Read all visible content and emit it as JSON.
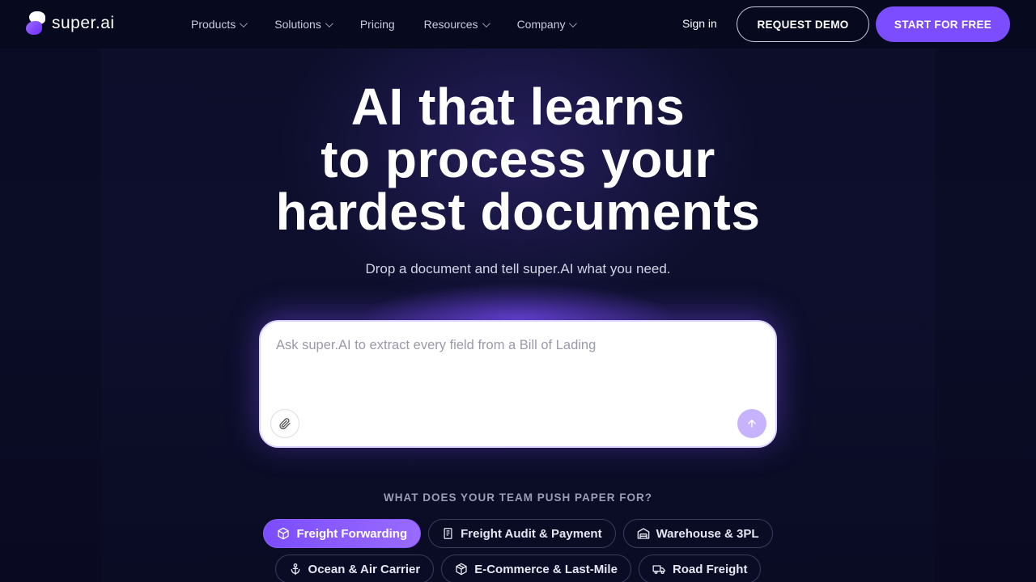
{
  "brand": {
    "name": "super.ai",
    "accent": "#7b4dff"
  },
  "nav": {
    "items": [
      {
        "label": "Products",
        "has_menu": true
      },
      {
        "label": "Solutions",
        "has_menu": true
      },
      {
        "label": "Pricing",
        "has_menu": false
      },
      {
        "label": "Resources",
        "has_menu": true
      },
      {
        "label": "Company",
        "has_menu": true
      }
    ],
    "sign_in": "Sign in",
    "request_demo": "REQUEST DEMO",
    "start_free": "START FOR FREE"
  },
  "hero": {
    "title_lines": [
      "AI that learns",
      "to process your",
      "hardest documents"
    ],
    "subtitle": "Drop a document and tell super.AI what you need."
  },
  "prompt": {
    "placeholder": "Ask super.AI to extract every field from a Bill of Lading",
    "attach_icon": "paperclip-icon",
    "send_icon": "arrow-up-icon"
  },
  "question": "WHAT DOES YOUR TEAM PUSH PAPER FOR?",
  "chips": [
    {
      "label": "Freight Forwarding",
      "icon": "box-icon",
      "active": true
    },
    {
      "label": "Freight Audit & Payment",
      "icon": "receipt-icon",
      "active": false
    },
    {
      "label": "Warehouse & 3PL",
      "icon": "warehouse-icon",
      "active": false
    },
    {
      "label": "Ocean & Air Carrier",
      "icon": "anchor-icon",
      "active": false
    },
    {
      "label": "E-Commerce & Last-Mile",
      "icon": "package-icon",
      "active": false
    },
    {
      "label": "Road Freight",
      "icon": "truck-icon",
      "active": false
    }
  ]
}
